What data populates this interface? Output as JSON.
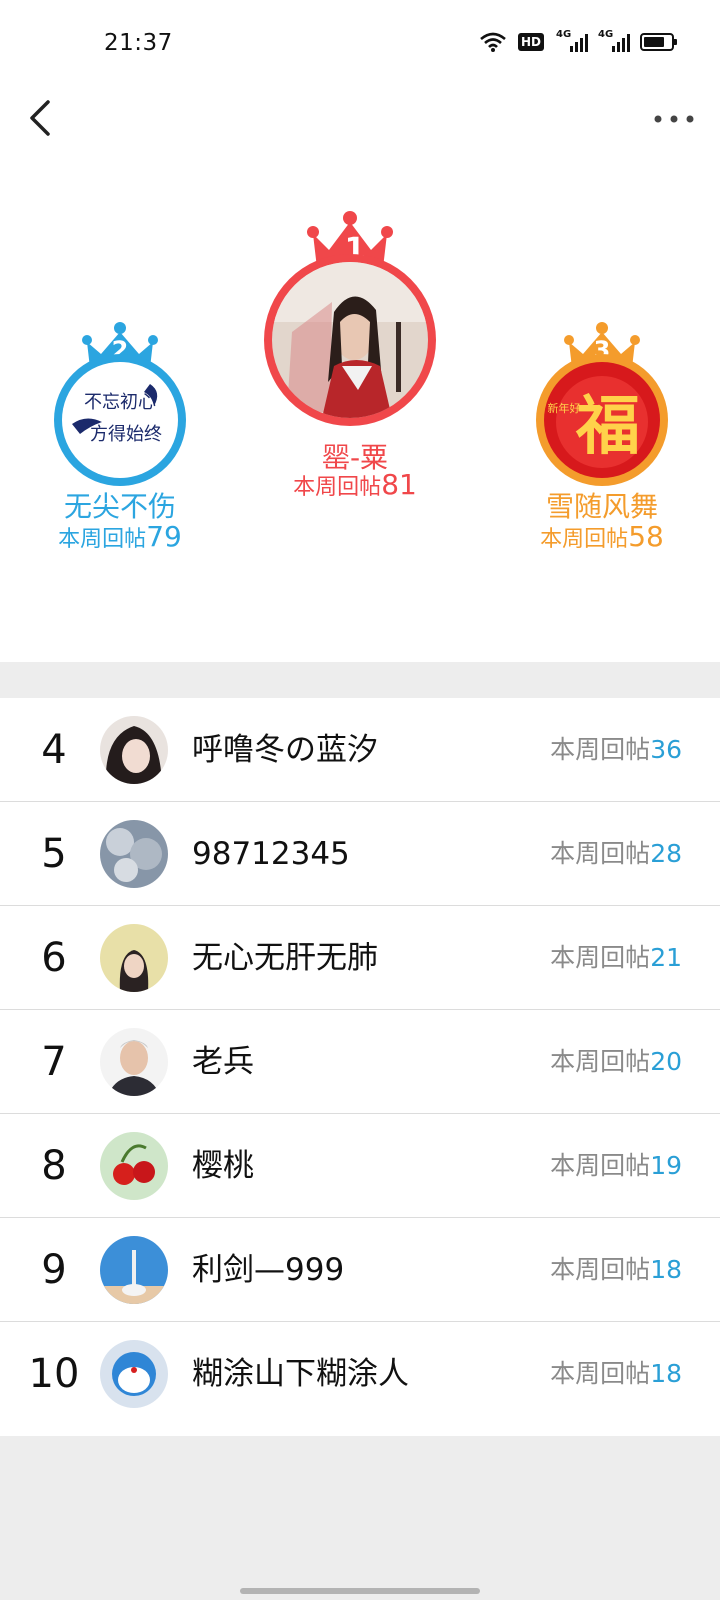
{
  "status_bar": {
    "time": "21:37",
    "network_badge": "HD",
    "sim1": "4G",
    "sim2": "4G"
  },
  "header": {
    "back_icon": "chevron-left-icon",
    "more_icon": "more-horizontal-icon"
  },
  "podium": [
    {
      "rank": "1",
      "name": "罂-粟",
      "count_label": "本周回帖",
      "count": "81",
      "color": "#f0474a"
    },
    {
      "rank": "2",
      "name": "无尖不伤",
      "count_label": "本周回帖",
      "count": "79",
      "color": "#2ba5e0"
    },
    {
      "rank": "3",
      "name": "雪随风舞",
      "count_label": "本周回帖",
      "count": "58",
      "color": "#f49c2c",
      "avatar_text": "福",
      "avatar_small_text": "新年好"
    }
  ],
  "avatar2_text": {
    "line1": "不忘初心",
    "line2": "方得始终"
  },
  "list": [
    {
      "rank": "4",
      "name": "呼噜冬の蓝汐",
      "count_label": "本周回帖",
      "count": "36"
    },
    {
      "rank": "5",
      "name": "98712345",
      "count_label": "本周回帖",
      "count": "28"
    },
    {
      "rank": "6",
      "name": "无心无肝无肺",
      "count_label": "本周回帖",
      "count": "21"
    },
    {
      "rank": "7",
      "name": "老兵",
      "count_label": "本周回帖",
      "count": "20"
    },
    {
      "rank": "8",
      "name": "樱桃",
      "count_label": "本周回帖",
      "count": "19"
    },
    {
      "rank": "9",
      "name": "利剑—999",
      "count_label": "本周回帖",
      "count": "18"
    },
    {
      "rank": "10",
      "name": "糊涂山下糊涂人",
      "count_label": "本周回帖",
      "count": "18"
    }
  ],
  "colors": {
    "accent_blue": "#2a9fd6",
    "gold": "#f49c2c",
    "red": "#f0474a"
  }
}
